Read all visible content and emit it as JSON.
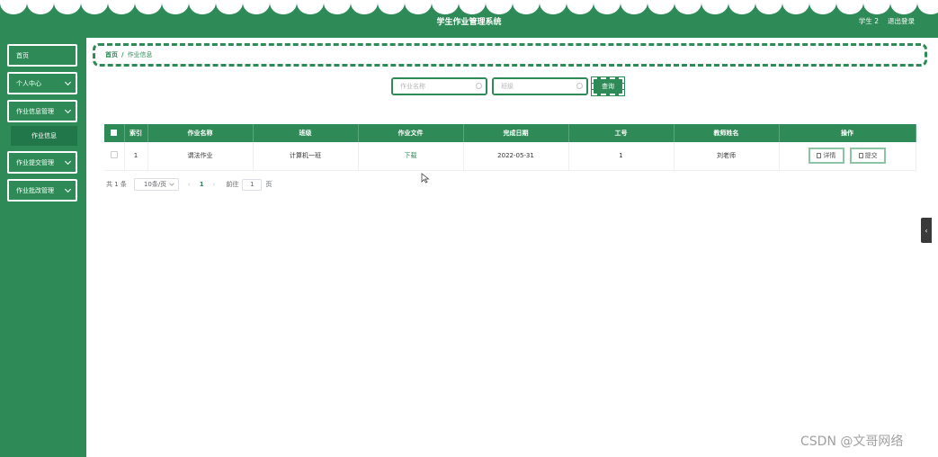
{
  "header": {
    "title": "学生作业管理系统",
    "user_label": "学生 2",
    "logout_label": "退出登录"
  },
  "sidebar": {
    "items": [
      {
        "label": "首页"
      },
      {
        "label": "个人中心"
      },
      {
        "label": "作业信息管理"
      },
      {
        "label": "作业信息"
      },
      {
        "label": "作业提交管理"
      },
      {
        "label": "作业批改管理"
      }
    ]
  },
  "breadcrumb": {
    "home": "首页",
    "separator": "/",
    "current": "作业信息"
  },
  "search": {
    "name_placeholder": "作业名称",
    "class_placeholder": "班级",
    "query_label": "查询"
  },
  "table": {
    "columns": [
      "索引",
      "作业名称",
      "班级",
      "作业文件",
      "完成日期",
      "工号",
      "教师姓名",
      "操作"
    ],
    "rows": [
      {
        "index": "1",
        "name": "谓法作业",
        "class": "计算机一班",
        "file": "下载",
        "date": "2022-05-31",
        "job_no": "1",
        "teacher": "刘老师",
        "detail_label": "详情",
        "submit_label": "提交"
      }
    ]
  },
  "pagination": {
    "total": "共 1 条",
    "page_size": "10条/页",
    "prev": "‹",
    "current_page": "1",
    "next": "›",
    "goto_label": "前往",
    "goto_value": "1",
    "page_unit": "页"
  },
  "edge_tab": {
    "glyph": "‹"
  },
  "watermark": "CSDN @文哥网络",
  "colors": {
    "primary": "#2e8b57",
    "header_text": "#ffffff"
  }
}
